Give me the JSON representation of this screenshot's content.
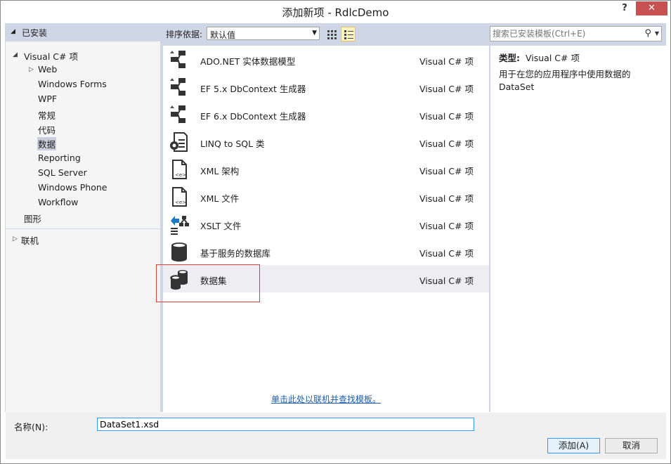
{
  "window": {
    "title": "添加新项 - RdlcDemo",
    "help_label": "?",
    "close_label": "✕"
  },
  "tree": {
    "installed_label": "已安装",
    "visual_cs_label": "Visual C# 项",
    "web_label": "Web",
    "items": [
      "Windows Forms",
      "WPF",
      "常规",
      "代码",
      "数据",
      "Reporting",
      "SQL Server",
      "Windows Phone",
      "Workflow"
    ],
    "graphics_label": "图形",
    "online_label": "联机"
  },
  "toolbar": {
    "sort_label": "排序依据:",
    "sort_value": "默认值"
  },
  "search": {
    "placeholder": "搜索已安装模板(Ctrl+E)"
  },
  "templates": [
    {
      "name": "ADO.NET 实体数据模型",
      "type": "Visual C# 项",
      "icon": "entity-model-icon"
    },
    {
      "name": "EF 5.x DbContext 生成器",
      "type": "Visual C# 项",
      "icon": "dbcontext-generator-icon"
    },
    {
      "name": "EF 6.x DbContext 生成器",
      "type": "Visual C# 项",
      "icon": "dbcontext-generator-icon"
    },
    {
      "name": "LINQ to SQL 类",
      "type": "Visual C# 项",
      "icon": "linq-to-sql-icon"
    },
    {
      "name": "XML 架构",
      "type": "Visual C# 项",
      "icon": "xml-schema-icon"
    },
    {
      "name": "XML 文件",
      "type": "Visual C# 项",
      "icon": "xml-file-icon"
    },
    {
      "name": "XSLT 文件",
      "type": "Visual C# 项",
      "icon": "xslt-file-icon"
    },
    {
      "name": "基于服务的数据库",
      "type": "Visual C# 项",
      "icon": "database-icon"
    },
    {
      "name": "数据集",
      "type": "Visual C# 项",
      "icon": "dataset-icon"
    }
  ],
  "online_link": "单击此处以联机并查找模板。",
  "description": {
    "type_label": "类型:",
    "type_value": "Visual C# 项",
    "text": "用于在您的应用程序中使用数据的 DataSet"
  },
  "name_field": {
    "label": "名称(N):",
    "value": "DataSet1.xsd"
  },
  "buttons": {
    "add": "添加(A)",
    "cancel": "取消"
  }
}
